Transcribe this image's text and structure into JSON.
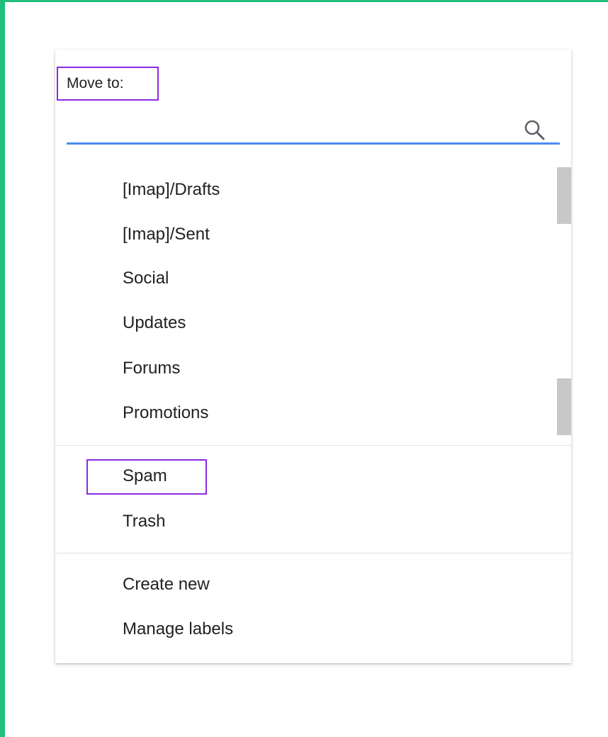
{
  "menu": {
    "heading": "Move to:",
    "search": {
      "value": "",
      "placeholder": "",
      "icon": "search-icon"
    },
    "folders": [
      {
        "label": "[Imap]/Drafts"
      },
      {
        "label": "[Imap]/Sent"
      },
      {
        "label": "Social"
      },
      {
        "label": "Updates"
      },
      {
        "label": "Forums"
      },
      {
        "label": "Promotions"
      }
    ],
    "system": [
      {
        "label": "Spam"
      },
      {
        "label": "Trash"
      }
    ],
    "actions": [
      {
        "label": "Create new"
      },
      {
        "label": "Manage labels"
      }
    ]
  },
  "colors": {
    "frame": "#20bf7c",
    "highlight": "#8a2be2",
    "search_underline": "#4c8bf5",
    "scroll_thumb": "#c8c8c8",
    "text": "#202124"
  }
}
